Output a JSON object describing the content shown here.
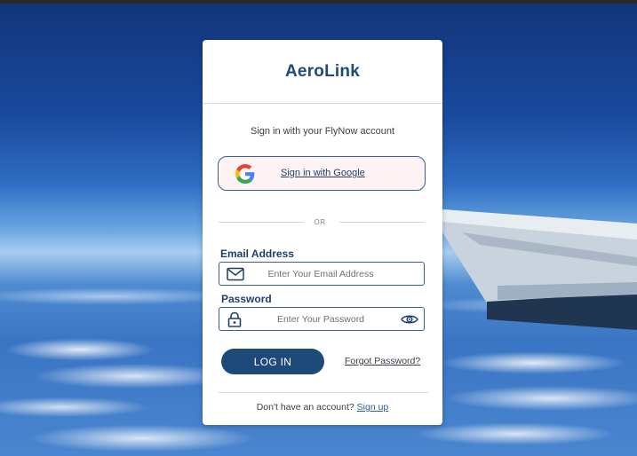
{
  "brand": {
    "name": "AeroLink"
  },
  "login": {
    "subtitle": "Sign in with your FlyNow account",
    "google_button_label": "Sign in with Google",
    "or_text": "OR",
    "email": {
      "label": "Email Address",
      "placeholder": "Enter Your Email Address",
      "value": ""
    },
    "password": {
      "label": "Password",
      "placeholder": "Enter Your Password",
      "value": ""
    },
    "login_button_label": "LOG IN",
    "forgot_password_label": "Forgot Password?",
    "signup_prompt": "Don't have an account?",
    "signup_link_label": "Sign up"
  },
  "icons": {
    "google": "google-g-icon",
    "email": "mail-icon",
    "password": "lock-icon",
    "toggle_password": "eye-icon"
  },
  "colors": {
    "brand_primary": "#1e4a7a",
    "google_button_bg": "#fdf4f3",
    "field_border": "#3b5f8a",
    "link": "#2c5fa8"
  }
}
